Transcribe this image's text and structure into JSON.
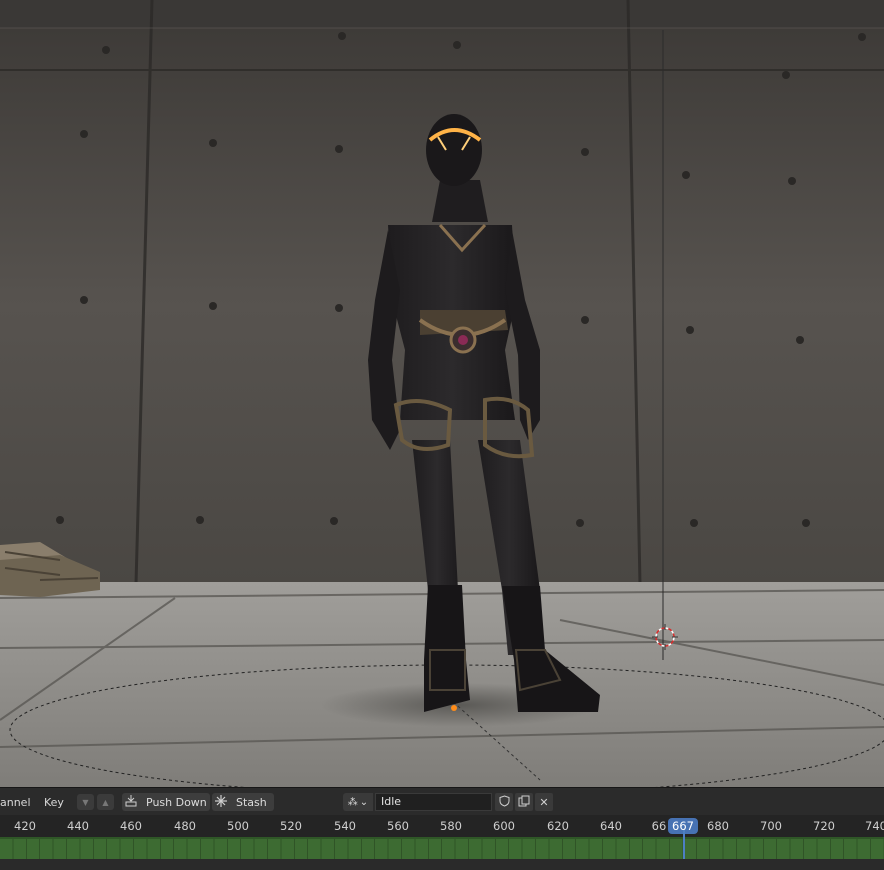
{
  "header": {
    "channel_label": "annel",
    "key_label": "Key",
    "down_arrow": "▼",
    "up_arrow": "▲",
    "push_down_icon": "push-down-icon",
    "push_down_label": "Push Down",
    "stash_icon": "stash-icon",
    "stash_label": "Stash",
    "action_type_glyph": "⁂",
    "action_type_chevron": "⌄",
    "action_name": "Idle",
    "fake_user_icon": "shield-icon",
    "duplicate_icon": "duplicate-icon",
    "unlink_icon": "close-icon",
    "unlink_glyph": "✕"
  },
  "timeline": {
    "ticks": [
      "420",
      "440",
      "460",
      "480",
      "500",
      "520",
      "540",
      "560",
      "580",
      "600",
      "620",
      "640",
      "66",
      "680",
      "700",
      "720",
      "740"
    ],
    "current_frame": "667",
    "accent_color": "#4772b3",
    "track_color": "#3d6b32"
  },
  "viewport": {
    "wall_color": "#4f4b47",
    "floor_color": "#8a8884"
  }
}
